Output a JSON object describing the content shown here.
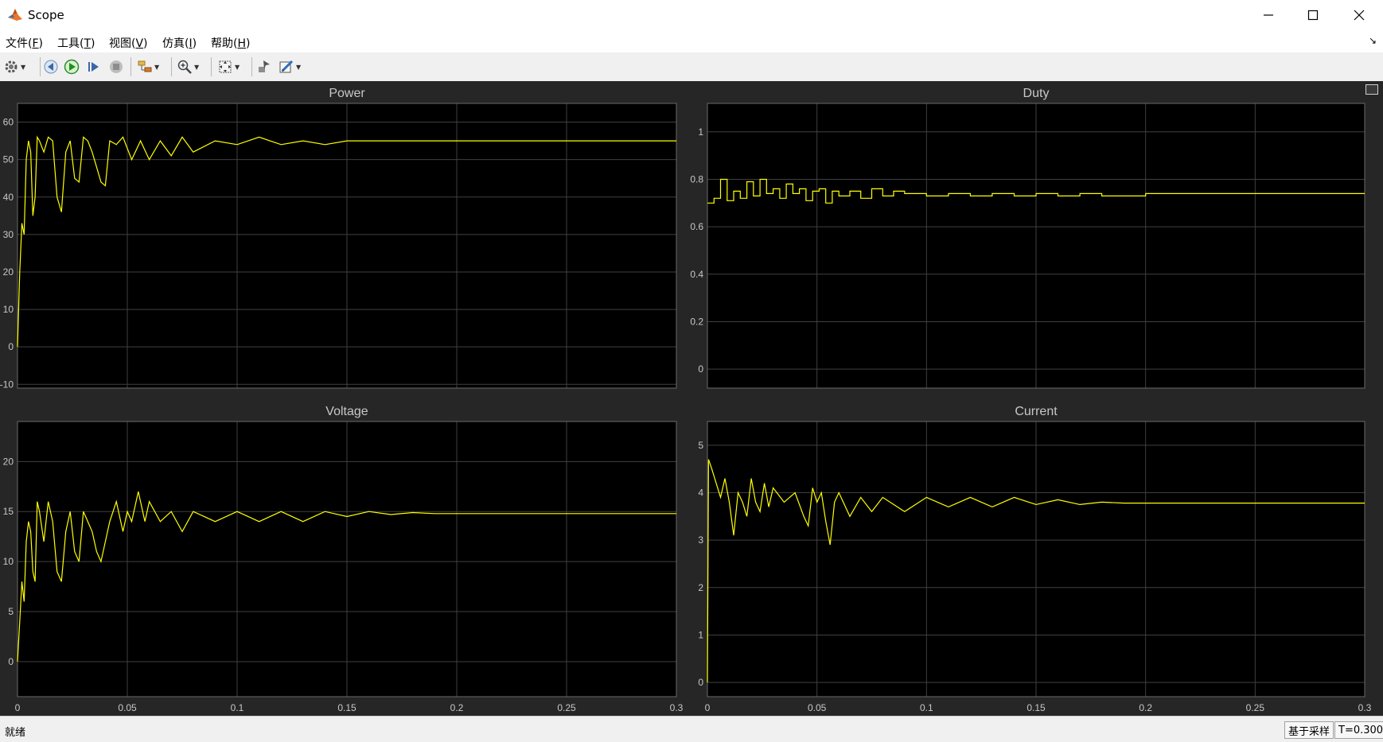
{
  "window": {
    "title": "Scope",
    "controls": [
      "minimize",
      "maximize",
      "close"
    ]
  },
  "menu": [
    {
      "label": "文件(",
      "key": "F",
      "tail": ")"
    },
    {
      "label": "工具(",
      "key": "T",
      "tail": ")"
    },
    {
      "label": "视图(",
      "key": "V",
      "tail": ")"
    },
    {
      "label": "仿真(",
      "key": "I",
      "tail": ")"
    },
    {
      "label": "帮助(",
      "key": "H",
      "tail": ")"
    }
  ],
  "toolbar": {
    "icons": [
      "settings-gear-icon",
      "step-back-icon",
      "run-icon",
      "step-forward-icon",
      "stop-icon",
      "signal-highlight-icon",
      "zoom-in-icon",
      "autoscale-icon",
      "inspect-icon",
      "edit-style-icon"
    ]
  },
  "colors": {
    "plot_background": "#000000",
    "figure_background": "#262626",
    "signal": "#ffff00",
    "grid": "#404040",
    "text": "#c8c8c8"
  },
  "chart_data": [
    {
      "type": "line",
      "title": "Power",
      "xlim": [
        0,
        0.3
      ],
      "ylim": [
        -11,
        65
      ],
      "xticks": [
        0,
        0.05,
        0.1,
        0.15,
        0.2,
        0.25,
        0.3
      ],
      "yticks": [
        -10,
        0,
        10,
        20,
        30,
        40,
        50,
        60
      ],
      "xticks_labeled": false,
      "grid": true,
      "series": [
        {
          "x": [
            0,
            0.001,
            0.002,
            0.003,
            0.004,
            0.005,
            0.006,
            0.007,
            0.008,
            0.009,
            0.01,
            0.012,
            0.014,
            0.016,
            0.018,
            0.02,
            0.022,
            0.024,
            0.026,
            0.028,
            0.03,
            0.032,
            0.034,
            0.036,
            0.038,
            0.04,
            0.042,
            0.045,
            0.048,
            0.052,
            0.056,
            0.06,
            0.065,
            0.07,
            0.075,
            0.08,
            0.09,
            0.1,
            0.11,
            0.12,
            0.13,
            0.14,
            0.15,
            0.16,
            0.17,
            0.18,
            0.19,
            0.2,
            0.25,
            0.3
          ],
          "y": [
            0,
            20,
            33,
            30,
            50,
            55,
            52,
            35,
            40,
            56,
            55,
            52,
            56,
            55,
            40,
            36,
            52,
            55,
            45,
            44,
            56,
            55,
            52,
            48,
            44,
            43,
            55,
            54,
            56,
            50,
            55,
            50,
            55,
            51,
            56,
            52,
            55,
            54,
            56,
            54,
            55,
            54,
            55,
            55,
            55,
            55,
            55,
            55,
            55,
            55
          ]
        }
      ]
    },
    {
      "type": "line",
      "title": "Duty",
      "xlim": [
        0,
        0.3
      ],
      "ylim": [
        -0.08,
        1.12
      ],
      "xticks": [
        0,
        0.05,
        0.1,
        0.15,
        0.2,
        0.25,
        0.3
      ],
      "yticks": [
        0,
        0.2,
        0.4,
        0.6,
        0.8,
        1
      ],
      "xticks_labeled": false,
      "grid": true,
      "series": [
        {
          "x": [
            0,
            0.003,
            0.006,
            0.009,
            0.012,
            0.015,
            0.018,
            0.021,
            0.024,
            0.027,
            0.03,
            0.033,
            0.036,
            0.039,
            0.042,
            0.045,
            0.048,
            0.051,
            0.054,
            0.057,
            0.06,
            0.065,
            0.07,
            0.075,
            0.08,
            0.085,
            0.09,
            0.1,
            0.11,
            0.12,
            0.13,
            0.14,
            0.15,
            0.16,
            0.17,
            0.18,
            0.2,
            0.25,
            0.3
          ],
          "y": [
            0.7,
            0.72,
            0.8,
            0.71,
            0.75,
            0.72,
            0.79,
            0.73,
            0.8,
            0.74,
            0.76,
            0.72,
            0.78,
            0.74,
            0.76,
            0.71,
            0.75,
            0.76,
            0.7,
            0.75,
            0.73,
            0.75,
            0.72,
            0.76,
            0.73,
            0.75,
            0.74,
            0.73,
            0.74,
            0.73,
            0.74,
            0.73,
            0.74,
            0.73,
            0.74,
            0.73,
            0.74,
            0.74,
            0.74
          ]
        }
      ]
    },
    {
      "type": "line",
      "title": "Voltage",
      "xlim": [
        0,
        0.3
      ],
      "ylim": [
        -3.5,
        24
      ],
      "xticks": [
        0,
        0.05,
        0.1,
        0.15,
        0.2,
        0.25,
        0.3
      ],
      "xtick_labels": [
        "0",
        "0.05",
        "0.1",
        "0.15",
        "0.2",
        "0.25",
        "0.3"
      ],
      "yticks": [
        0,
        5,
        10,
        15,
        20
      ],
      "grid": true,
      "series": [
        {
          "x": [
            0,
            0.001,
            0.002,
            0.003,
            0.004,
            0.005,
            0.006,
            0.007,
            0.008,
            0.009,
            0.01,
            0.012,
            0.014,
            0.016,
            0.018,
            0.02,
            0.022,
            0.024,
            0.026,
            0.028,
            0.03,
            0.032,
            0.034,
            0.036,
            0.038,
            0.04,
            0.042,
            0.045,
            0.048,
            0.05,
            0.052,
            0.055,
            0.058,
            0.06,
            0.065,
            0.07,
            0.075,
            0.08,
            0.09,
            0.1,
            0.11,
            0.12,
            0.13,
            0.14,
            0.15,
            0.16,
            0.17,
            0.18,
            0.19,
            0.2,
            0.25,
            0.3
          ],
          "y": [
            0,
            4,
            8,
            6,
            12,
            14,
            13,
            9,
            8,
            16,
            15,
            12,
            16,
            14,
            9,
            8,
            13,
            15,
            11,
            10,
            15,
            14,
            13,
            11,
            10,
            12,
            14,
            16,
            13,
            15,
            14,
            17,
            14,
            16,
            14,
            15,
            13,
            15,
            14,
            15,
            14,
            15,
            14,
            15,
            14.5,
            15,
            14.7,
            14.9,
            14.8,
            14.8,
            14.8,
            14.8
          ]
        }
      ]
    },
    {
      "type": "line",
      "title": "Current",
      "xlim": [
        0,
        0.3
      ],
      "ylim": [
        -0.3,
        5.5
      ],
      "xticks": [
        0,
        0.05,
        0.1,
        0.15,
        0.2,
        0.25,
        0.3
      ],
      "xtick_labels": [
        "0",
        "0.05",
        "0.1",
        "0.15",
        "0.2",
        "0.25",
        "0.3"
      ],
      "yticks": [
        0,
        1,
        2,
        3,
        4,
        5
      ],
      "grid": true,
      "series": [
        {
          "x": [
            0,
            0.0005,
            0.002,
            0.004,
            0.006,
            0.008,
            0.01,
            0.012,
            0.014,
            0.016,
            0.018,
            0.02,
            0.022,
            0.024,
            0.026,
            0.028,
            0.03,
            0.035,
            0.04,
            0.044,
            0.046,
            0.048,
            0.05,
            0.052,
            0.054,
            0.056,
            0.058,
            0.06,
            0.065,
            0.07,
            0.075,
            0.08,
            0.09,
            0.1,
            0.11,
            0.12,
            0.13,
            0.14,
            0.15,
            0.16,
            0.17,
            0.18,
            0.19,
            0.2,
            0.25,
            0.3
          ],
          "y": [
            0,
            4.7,
            4.5,
            4.2,
            3.9,
            4.3,
            3.8,
            3.1,
            4.0,
            3.8,
            3.5,
            4.3,
            3.8,
            3.6,
            4.2,
            3.7,
            4.1,
            3.8,
            4.0,
            3.5,
            3.3,
            4.1,
            3.8,
            4.0,
            3.4,
            2.9,
            3.8,
            4.0,
            3.5,
            3.9,
            3.6,
            3.9,
            3.6,
            3.9,
            3.7,
            3.9,
            3.7,
            3.9,
            3.75,
            3.85,
            3.75,
            3.8,
            3.78,
            3.78,
            3.78,
            3.78
          ]
        }
      ]
    }
  ],
  "status": {
    "text": "就绪",
    "sample_mode": "基于采样",
    "time": "T=0.300"
  }
}
